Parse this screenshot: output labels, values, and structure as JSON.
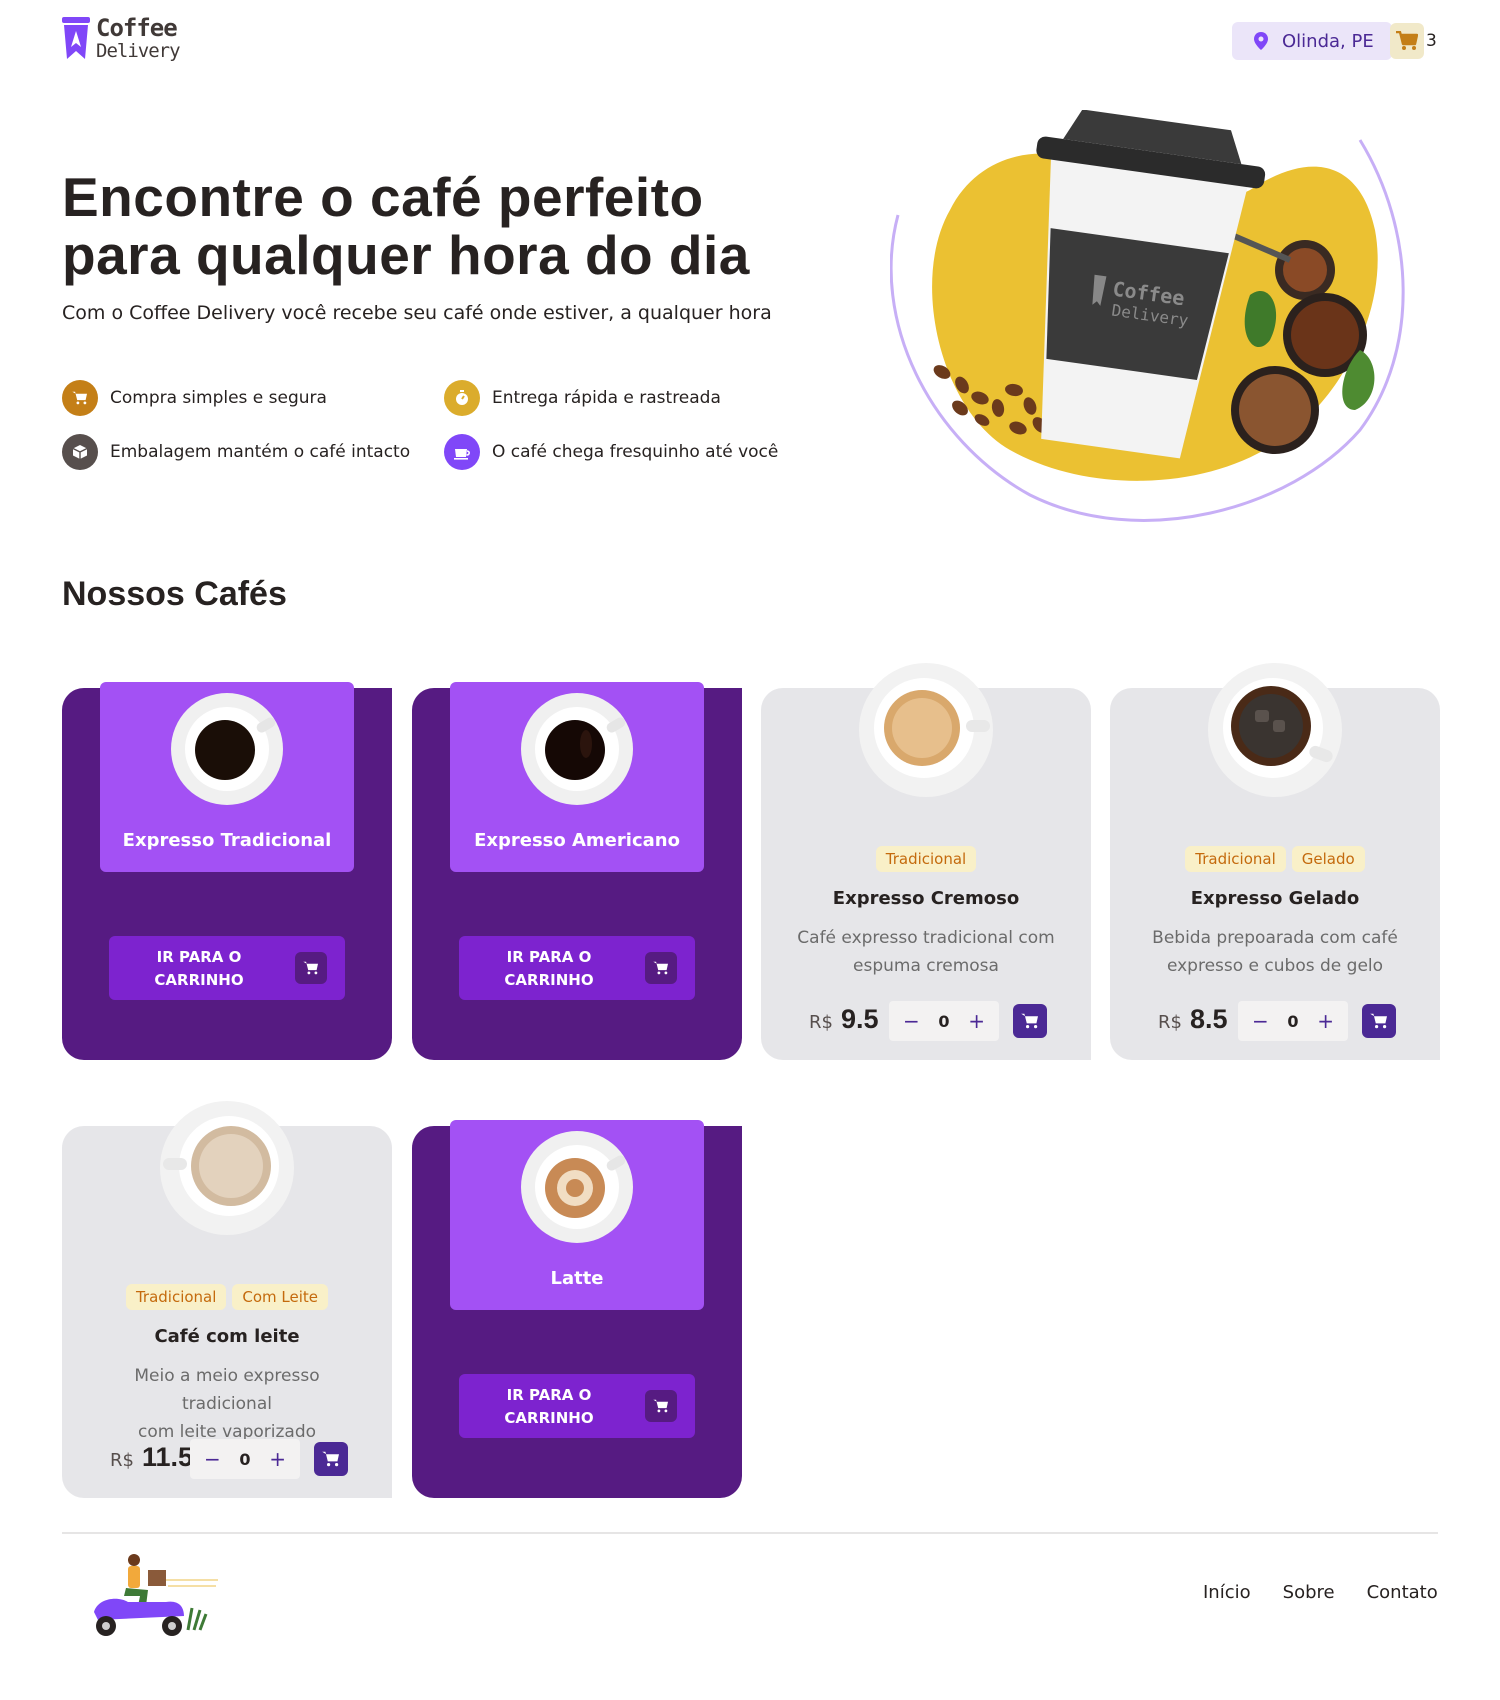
{
  "header": {
    "logo_line1": "Coffee",
    "logo_line2": "Delivery",
    "location": "Olinda, PE",
    "cart_count": "3"
  },
  "hero": {
    "title_line1": "Encontre o café perfeito",
    "title_line2": "para qualquer hora do dia",
    "subtitle": "Com o Coffee Delivery você recebe seu café onde estiver, a qualquer hora",
    "features": [
      {
        "label": "Compra simples e segura",
        "icon": "cart-icon",
        "color": "#C47F17"
      },
      {
        "label": "Entrega rápida e rastreada",
        "icon": "timer-icon",
        "color": "#DBAC2C"
      },
      {
        "label": "Embalagem mantém o café intacto",
        "icon": "package-icon",
        "color": "#574F4D"
      },
      {
        "label": "O café chega fresquinho até você",
        "icon": "coffee-icon",
        "color": "#8047F8"
      }
    ],
    "art_cup_brand_line1": "Coffee",
    "art_cup_brand_line2": "Delivery"
  },
  "section_title": "Nossos Cafés",
  "products": [
    {
      "name": "Expresso Tradicional",
      "state": "selected",
      "button": "IR PARA O CARRINHO"
    },
    {
      "name": "Expresso Americano",
      "state": "selected",
      "button": "IR PARA O CARRINHO"
    },
    {
      "name": "Expresso Cremoso",
      "state": "normal",
      "tags": [
        "Tradicional"
      ],
      "desc_line1": "Café expresso tradicional com",
      "desc_line2": "espuma cremosa",
      "currency": "R$",
      "price": "9.5",
      "qty": "0"
    },
    {
      "name": "Expresso Gelado",
      "state": "normal",
      "tags": [
        "Tradicional",
        "Gelado"
      ],
      "desc_line1": "Bebida prepoarada com café",
      "desc_line2": "expresso e cubos de gelo",
      "currency": "R$",
      "price": "8.5",
      "qty": "0"
    },
    {
      "name": "Café com leite",
      "state": "normal",
      "tags": [
        "Tradicional",
        "Com Leite"
      ],
      "desc_line1": "Meio a meio expresso tradicional",
      "desc_line2": "com leite vaporizado",
      "currency": "R$",
      "price": "11.5",
      "qty": "0"
    },
    {
      "name": "Latte",
      "state": "selected",
      "button": "IR PARA O CARRINHO"
    }
  ],
  "stepper": {
    "minus": "−",
    "plus": "+"
  },
  "footer": {
    "links": [
      "Início",
      "Sobre",
      "Contato"
    ]
  },
  "colors": {
    "purple_dark": "#561B82",
    "purple": "#A351F4",
    "purple_button": "#7D23CF",
    "yellow": "#DBAC2C",
    "card_grey": "#E6E6E9"
  }
}
